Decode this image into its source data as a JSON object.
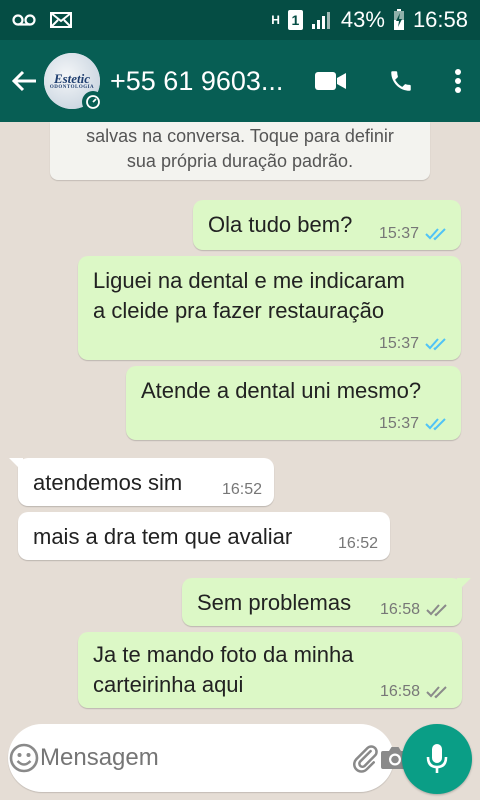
{
  "status_bar": {
    "battery": "43%",
    "time": "16:58",
    "sim_label": "1",
    "net_label": "H"
  },
  "header": {
    "contact": "+55 61 9603...",
    "avatar_text": "Estetic",
    "avatar_subtext": "ODONTOLOGIA"
  },
  "system_note": {
    "line1": "salvas na conversa. Toque para definir",
    "line2": "sua própria duração padrão."
  },
  "messages": [
    {
      "dir": "out",
      "line1": "Ola tudo bem?",
      "time": "15:37",
      "status": "read"
    },
    {
      "dir": "out",
      "line1": "Liguei na dental e me indicaram",
      "line2": "a cleide pra fazer restauração",
      "time": "15:37",
      "status": "read"
    },
    {
      "dir": "out",
      "line1": "Atende a dental uni mesmo?",
      "time": "15:37",
      "status": "read"
    },
    {
      "dir": "in",
      "line1": "atendemos sim",
      "time": "16:52"
    },
    {
      "dir": "in",
      "line1": "mais a dra tem que avaliar",
      "time": "16:52"
    },
    {
      "dir": "out",
      "line1": "Sem problemas",
      "time": "16:58",
      "status": "delivered"
    },
    {
      "dir": "out",
      "line1": "Ja te mando foto da minha",
      "line2": "carteirinha aqui",
      "time": "16:58",
      "status": "delivered"
    }
  ],
  "input": {
    "placeholder": "Mensagem"
  },
  "colors": {
    "app_bar": "#075e54",
    "status_bar": "#054d44",
    "outgoing": "#dcf8c6",
    "incoming": "#ffffff",
    "read_ticks": "#4fc3f7",
    "mic_button": "#0a9e86"
  },
  "icons": [
    "voicemail-icon",
    "mail-icon",
    "signal-icon",
    "battery-icon",
    "back-arrow-icon",
    "timer-icon",
    "video-call-icon",
    "phone-icon",
    "more-vert-icon",
    "emoji-icon",
    "attach-icon",
    "camera-icon",
    "mic-icon",
    "double-check-icon"
  ]
}
